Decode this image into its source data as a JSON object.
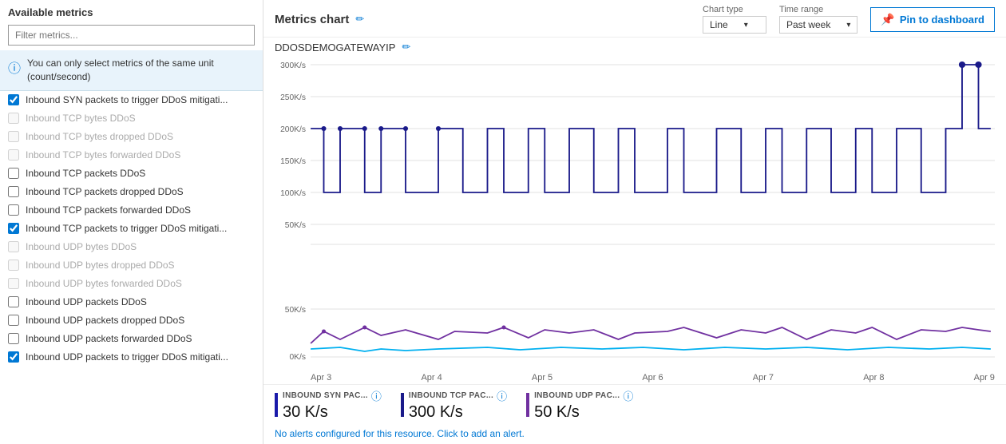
{
  "left_panel": {
    "header": "Available metrics",
    "filter_placeholder": "Filter metrics...",
    "info_text": "You can only select metrics of the same unit (count/second)",
    "metrics": [
      {
        "id": "m1",
        "label": "Inbound SYN packets to trigger DDoS mitigati...",
        "checked": true,
        "disabled": false
      },
      {
        "id": "m2",
        "label": "Inbound TCP bytes DDoS",
        "checked": false,
        "disabled": true
      },
      {
        "id": "m3",
        "label": "Inbound TCP bytes dropped DDoS",
        "checked": false,
        "disabled": true
      },
      {
        "id": "m4",
        "label": "Inbound TCP bytes forwarded DDoS",
        "checked": false,
        "disabled": true
      },
      {
        "id": "m5",
        "label": "Inbound TCP packets DDoS",
        "checked": false,
        "disabled": false
      },
      {
        "id": "m6",
        "label": "Inbound TCP packets dropped DDoS",
        "checked": false,
        "disabled": false
      },
      {
        "id": "m7",
        "label": "Inbound TCP packets forwarded DDoS",
        "checked": false,
        "disabled": false
      },
      {
        "id": "m8",
        "label": "Inbound TCP packets to trigger DDoS mitigati...",
        "checked": true,
        "disabled": false
      },
      {
        "id": "m9",
        "label": "Inbound UDP bytes DDoS",
        "checked": false,
        "disabled": true
      },
      {
        "id": "m10",
        "label": "Inbound UDP bytes dropped DDoS",
        "checked": false,
        "disabled": true
      },
      {
        "id": "m11",
        "label": "Inbound UDP bytes forwarded DDoS",
        "checked": false,
        "disabled": true
      },
      {
        "id": "m12",
        "label": "Inbound UDP packets DDoS",
        "checked": false,
        "disabled": false
      },
      {
        "id": "m13",
        "label": "Inbound UDP packets dropped DDoS",
        "checked": false,
        "disabled": false
      },
      {
        "id": "m14",
        "label": "Inbound UDP packets forwarded DDoS",
        "checked": false,
        "disabled": false
      },
      {
        "id": "m15",
        "label": "Inbound UDP packets to trigger DDoS mitigati...",
        "checked": true,
        "disabled": false
      }
    ]
  },
  "chart": {
    "title": "Metrics chart",
    "resource_name": "DDOSDEMOGATEWAYIP",
    "chart_type_label": "Chart type",
    "chart_type_value": "Line",
    "time_range_label": "Time range",
    "time_range_value": "Past week",
    "pin_label": "Pin to dashboard",
    "x_axis_labels": [
      "Apr 3",
      "Apr 4",
      "Apr 5",
      "Apr 6",
      "Apr 7",
      "Apr 8",
      "Apr 9"
    ],
    "y_axis_main": [
      "300K/s",
      "250K/s",
      "200K/s",
      "150K/s",
      "100K/s",
      "50K/s"
    ],
    "y_axis_sub": [
      "50K/s",
      "0K/s"
    ],
    "legend": [
      {
        "id": "l1",
        "name": "INBOUND SYN PAC...",
        "value": "30 K/s",
        "color": "#1a1aaa"
      },
      {
        "id": "l2",
        "name": "INBOUND TCP PAC...",
        "value": "300 K/s",
        "color": "#1a1a8a"
      },
      {
        "id": "l3",
        "name": "INBOUND UDP PAC...",
        "value": "50 K/s",
        "color": "#7030a0"
      }
    ],
    "alert_text": "No alerts configured for this resource. Click to add an alert."
  }
}
